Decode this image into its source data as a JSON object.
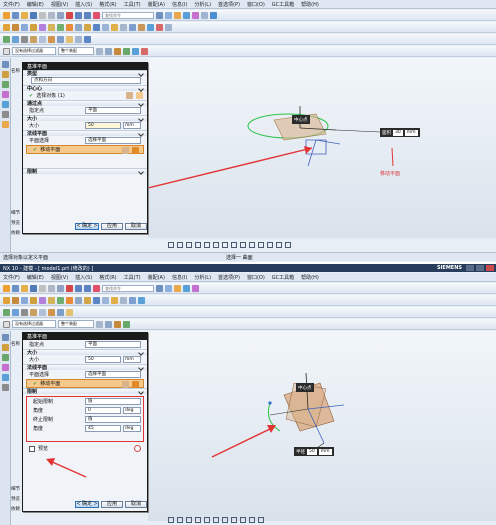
{
  "top": {
    "menu": [
      "文件(F)",
      "编辑(E)",
      "视图(V)",
      "插入(S)",
      "格式(R)",
      "工具(T)",
      "装配(A)",
      "信息(I)",
      "分析(L)",
      "首选项(P)",
      "窗口(O)",
      "GC工具箱",
      "帮助(H)"
    ],
    "search_placeholder": "查找命令",
    "filter_value": "没有选择过滤器",
    "filter2_value": "整个装配",
    "dialog": {
      "title": "基准平面",
      "type_section": "类型",
      "type_value": "点和方向",
      "center_section": "中心心",
      "select_object": "选择对象 (1)",
      "through_section": "通过点",
      "through_label": "指定点",
      "through_value": "平面",
      "size_section": "大小",
      "size_label": "大小",
      "size_value": "50",
      "size_unit": "mm",
      "plane_section": "法线平面",
      "plane_select_label": "平面选择",
      "plane_select_value": "选择平面",
      "move_plane_label": "移动平面",
      "limits_section": "限制",
      "ok": "< 确定 >",
      "apply": "应用",
      "cancel": "取消"
    },
    "handle_label": "中心点",
    "ctrl_label": "面积",
    "ctrl_value": "30",
    "ctrl_unit": "mm",
    "annotation": "移动平面",
    "status_left": "选择对象以定义平面",
    "status_mid": "选择一 曲面",
    "side_tabs": [
      "名称",
      "部件",
      "相关",
      "细节",
      "预览",
      "依赖"
    ]
  },
  "bottom": {
    "title": "NX 10 - 建模 - [ model1.prt  (修改的) ]",
    "brand": "SIEMENS",
    "menu": [
      "文件(F)",
      "编辑(E)",
      "视图(V)",
      "插入(S)",
      "格式(R)",
      "工具(T)",
      "装配(A)",
      "信息(I)",
      "分析(L)",
      "首选项(P)",
      "窗口(O)",
      "GC工具箱",
      "帮助(H)"
    ],
    "search_placeholder": "查找命令",
    "filter_value": "没有选择过滤器",
    "filter2_value": "整个装配",
    "dialog": {
      "title": "基准平面",
      "through_label": "指定点",
      "through_value": "平面",
      "size_section": "大小",
      "size_label": "大小",
      "size_value": "50",
      "size_unit": "mm",
      "plane_section": "法线平面",
      "plane_select_label": "平面选择",
      "plane_select_value": "选择平面",
      "move_plane_label": "移动平面",
      "limits_section": "限制",
      "limit_start_label": "起始限制",
      "limit_start_value": "值",
      "angle_label": "角度",
      "angle_value": "0",
      "angle_unit": "deg",
      "limit_end_label": "终止限制",
      "limit_end_value": "值",
      "angle2_label": "角度",
      "angle2_value": "45",
      "angle2_unit": "deg",
      "preview_label": "预览",
      "ok": "< 确定 >",
      "apply": "应用",
      "cancel": "取消"
    },
    "handle_label": "中心点",
    "ctrl_label": "半径",
    "ctrl_value": "50",
    "ctrl_unit": "mm",
    "side_tabs": [
      "名称",
      "部件",
      "相关",
      "细节",
      "预览",
      "依赖"
    ]
  }
}
